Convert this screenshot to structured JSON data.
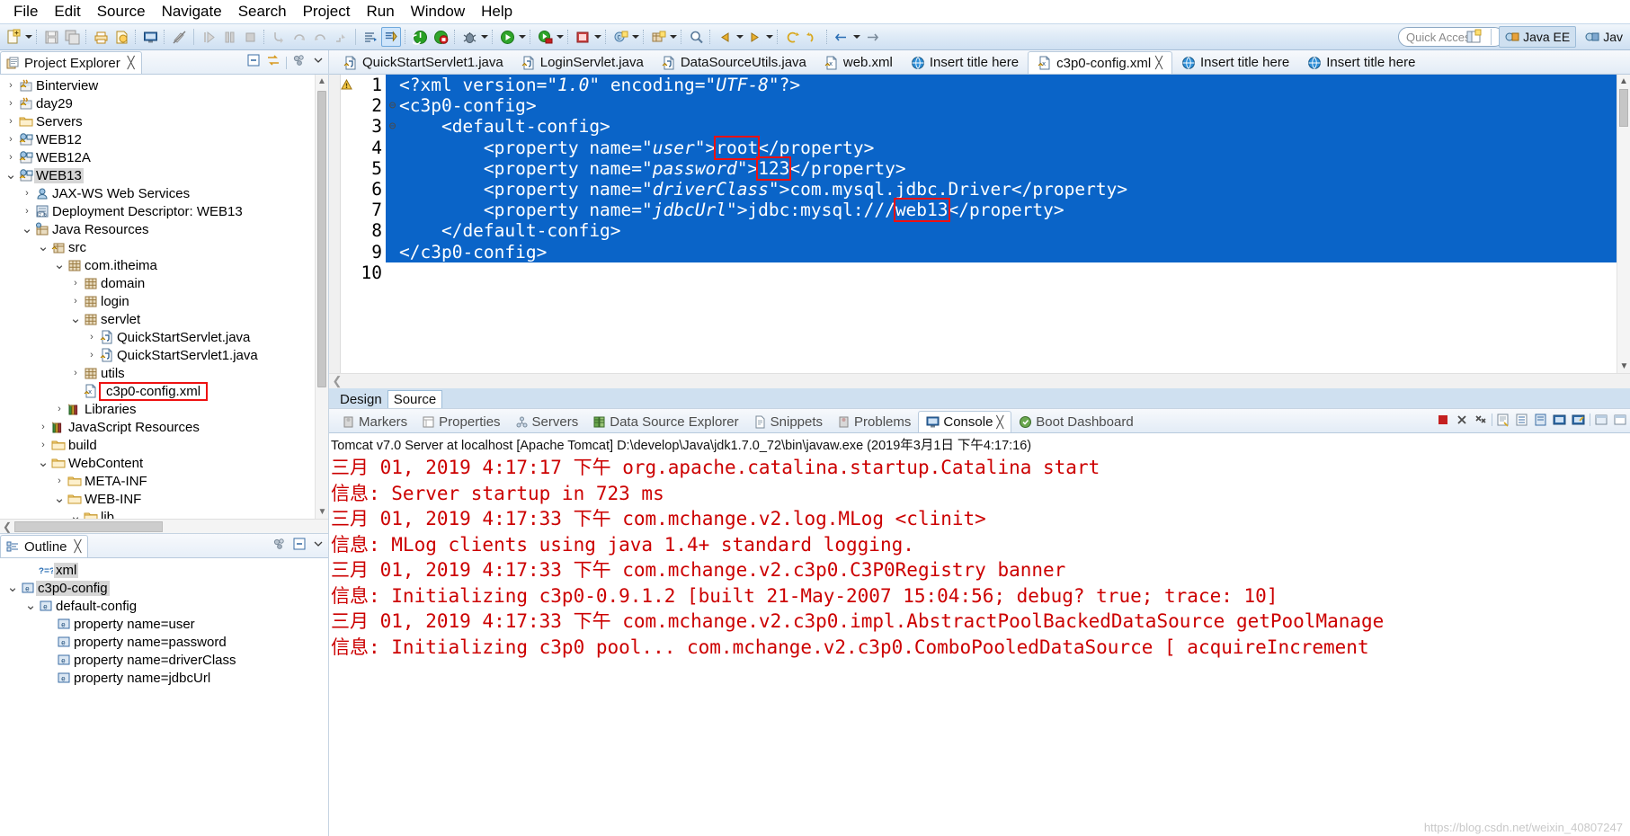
{
  "menu": {
    "items": [
      "File",
      "Edit",
      "Source",
      "Navigate",
      "Search",
      "Project",
      "Run",
      "Window",
      "Help"
    ]
  },
  "toolbar": {
    "quick_access_placeholder": "Quick Access",
    "perspectives": [
      {
        "label": "Java EE",
        "icon": "java-ee-perspective-icon"
      },
      {
        "label": "Jav",
        "icon": "java-perspective-icon"
      }
    ]
  },
  "project_explorer": {
    "title": "Project Explorer",
    "close_glyph": "╳",
    "items": [
      {
        "label": "Binterview",
        "indent": 0,
        "arrow": "›",
        "icon": "java-project-icon",
        "selected": false,
        "boxed": false
      },
      {
        "label": "day29",
        "indent": 0,
        "arrow": "›",
        "icon": "java-project-icon",
        "selected": false,
        "boxed": false
      },
      {
        "label": "Servers",
        "indent": 0,
        "arrow": "›",
        "icon": "folder-icon",
        "selected": false,
        "boxed": false
      },
      {
        "label": "WEB12",
        "indent": 0,
        "arrow": "›",
        "icon": "web-project-icon",
        "selected": false,
        "boxed": false
      },
      {
        "label": "WEB12A",
        "indent": 0,
        "arrow": "›",
        "icon": "web-project-icon",
        "selected": false,
        "boxed": false
      },
      {
        "label": "WEB13",
        "indent": 0,
        "arrow": "⌄",
        "icon": "web-project-icon",
        "selected": true,
        "boxed": false
      },
      {
        "label": "JAX-WS Web Services",
        "indent": 1,
        "arrow": "›",
        "icon": "jaxws-icon",
        "selected": false,
        "boxed": false
      },
      {
        "label": "Deployment Descriptor: WEB13",
        "indent": 1,
        "arrow": "›",
        "icon": "deployment-descriptor-icon",
        "selected": false,
        "boxed": false
      },
      {
        "label": "Java Resources",
        "indent": 1,
        "arrow": "⌄",
        "icon": "java-resources-icon",
        "selected": false,
        "boxed": false
      },
      {
        "label": "src",
        "indent": 2,
        "arrow": "⌄",
        "icon": "source-folder-icon",
        "selected": false,
        "boxed": false
      },
      {
        "label": "com.itheima",
        "indent": 3,
        "arrow": "⌄",
        "icon": "package-icon",
        "selected": false,
        "boxed": false
      },
      {
        "label": "domain",
        "indent": 4,
        "arrow": "›",
        "icon": "package-icon",
        "selected": false,
        "boxed": false
      },
      {
        "label": "login",
        "indent": 4,
        "arrow": "›",
        "icon": "package-icon",
        "selected": false,
        "boxed": false
      },
      {
        "label": "servlet",
        "indent": 4,
        "arrow": "⌄",
        "icon": "package-icon",
        "selected": false,
        "boxed": false
      },
      {
        "label": "QuickStartServlet.java",
        "indent": 5,
        "arrow": "›",
        "icon": "java-file-icon",
        "selected": false,
        "boxed": false
      },
      {
        "label": "QuickStartServlet1.java",
        "indent": 5,
        "arrow": "›",
        "icon": "java-file-icon",
        "selected": false,
        "boxed": false
      },
      {
        "label": "utils",
        "indent": 4,
        "arrow": "›",
        "icon": "package-icon",
        "selected": false,
        "boxed": false
      },
      {
        "label": "c3p0-config.xml",
        "indent": 4,
        "arrow": "",
        "icon": "xml-file-icon",
        "selected": false,
        "boxed": true
      },
      {
        "label": "Libraries",
        "indent": 3,
        "arrow": "›",
        "icon": "libraries-icon",
        "selected": false,
        "boxed": false
      },
      {
        "label": "JavaScript Resources",
        "indent": 2,
        "arrow": "›",
        "icon": "libraries-icon",
        "selected": false,
        "boxed": false
      },
      {
        "label": "build",
        "indent": 2,
        "arrow": "›",
        "icon": "folder-icon",
        "selected": false,
        "boxed": false
      },
      {
        "label": "WebContent",
        "indent": 2,
        "arrow": "⌄",
        "icon": "folder-icon",
        "selected": false,
        "boxed": false
      },
      {
        "label": "META-INF",
        "indent": 3,
        "arrow": "›",
        "icon": "folder-icon",
        "selected": false,
        "boxed": false
      },
      {
        "label": "WEB-INF",
        "indent": 3,
        "arrow": "⌄",
        "icon": "folder-icon",
        "selected": false,
        "boxed": false
      },
      {
        "label": "lib",
        "indent": 4,
        "arrow": "⌄",
        "icon": "folder-icon",
        "selected": false,
        "boxed": false
      }
    ]
  },
  "outline": {
    "title": "Outline",
    "close_glyph": "╳",
    "items": [
      {
        "label": "xml",
        "indent": 1,
        "arrow": "",
        "icon": "processing-instruction-icon",
        "selected": true
      },
      {
        "label": "c3p0-config",
        "indent": 0,
        "arrow": "⌄",
        "icon": "element-icon",
        "selected": true
      },
      {
        "label": "default-config",
        "indent": 1,
        "arrow": "⌄",
        "icon": "element-icon",
        "selected": false
      },
      {
        "label": "property name=user",
        "indent": 2,
        "arrow": "",
        "icon": "element-icon",
        "selected": false
      },
      {
        "label": "property name=password",
        "indent": 2,
        "arrow": "",
        "icon": "element-icon",
        "selected": false
      },
      {
        "label": "property name=driverClass",
        "indent": 2,
        "arrow": "",
        "icon": "element-icon",
        "selected": false
      },
      {
        "label": "property name=jdbcUrl",
        "indent": 2,
        "arrow": "",
        "icon": "element-icon",
        "selected": false
      }
    ]
  },
  "editor": {
    "tabs": [
      {
        "label": "QuickStartServlet1.java",
        "icon": "java-file-icon",
        "active": false,
        "closable": false
      },
      {
        "label": "LoginServlet.java",
        "icon": "java-file-icon",
        "active": false,
        "closable": false
      },
      {
        "label": "DataSourceUtils.java",
        "icon": "java-file-icon",
        "active": false,
        "closable": false
      },
      {
        "label": "web.xml",
        "icon": "xml-file-icon",
        "active": false,
        "closable": false
      },
      {
        "label": "Insert title here",
        "icon": "html-file-icon",
        "active": false,
        "closable": false
      },
      {
        "label": "c3p0-config.xml",
        "icon": "xml-file-icon",
        "active": true,
        "closable": true
      },
      {
        "label": "Insert title here",
        "icon": "html-file-icon",
        "active": false,
        "closable": false
      },
      {
        "label": "Insert title here",
        "icon": "html-file-icon",
        "active": false,
        "closable": false
      }
    ],
    "close_glyph": "╳",
    "bottom_tabs": [
      {
        "label": "Design",
        "active": false
      },
      {
        "label": "Source",
        "active": true
      }
    ],
    "code_lines": [
      {
        "no": "1",
        "fold": "",
        "selected": true,
        "warn": true,
        "segments": [
          {
            "t": "<?xml version=",
            "style": "plain"
          },
          {
            "t": "\"1.0\"",
            "style": "italic"
          },
          {
            "t": " encoding=",
            "style": "plain"
          },
          {
            "t": "\"UTF-8\"",
            "style": "italic"
          },
          {
            "t": "?>",
            "style": "plain"
          }
        ]
      },
      {
        "no": "2",
        "fold": "⊖",
        "selected": true,
        "warn": false,
        "segments": [
          {
            "t": "<c3p0-config>",
            "style": "plain"
          }
        ]
      },
      {
        "no": "3",
        "fold": "⊖",
        "selected": true,
        "warn": false,
        "segments": [
          {
            "t": "    <default-config>",
            "style": "plain"
          }
        ]
      },
      {
        "no": "4",
        "fold": "",
        "selected": true,
        "warn": false,
        "segments": [
          {
            "t": "        <property name=",
            "style": "plain"
          },
          {
            "t": "\"user\"",
            "style": "italic"
          },
          {
            "t": ">",
            "style": "plain"
          },
          {
            "t": "root",
            "style": "boxed"
          },
          {
            "t": "</property>",
            "style": "plain"
          }
        ]
      },
      {
        "no": "5",
        "fold": "",
        "selected": true,
        "warn": false,
        "segments": [
          {
            "t": "        <property name=",
            "style": "plain"
          },
          {
            "t": "\"password\"",
            "style": "italic"
          },
          {
            "t": ">",
            "style": "plain"
          },
          {
            "t": "123",
            "style": "boxed"
          },
          {
            "t": "</property>",
            "style": "plain"
          }
        ]
      },
      {
        "no": "6",
        "fold": "",
        "selected": true,
        "warn": false,
        "segments": [
          {
            "t": "        <property name=",
            "style": "plain"
          },
          {
            "t": "\"driverClass\"",
            "style": "italic"
          },
          {
            "t": ">com.mysql.jdbc.Driver</property>",
            "style": "plain"
          }
        ]
      },
      {
        "no": "7",
        "fold": "",
        "selected": true,
        "warn": false,
        "segments": [
          {
            "t": "        <property name=",
            "style": "plain"
          },
          {
            "t": "\"jdbcUrl\"",
            "style": "italic"
          },
          {
            "t": ">jdbc:mysql:///",
            "style": "plain"
          },
          {
            "t": "web13",
            "style": "boxed"
          },
          {
            "t": "</property>",
            "style": "plain"
          }
        ]
      },
      {
        "no": "8",
        "fold": "",
        "selected": true,
        "warn": false,
        "segments": [
          {
            "t": "    </default-config>",
            "style": "plain"
          }
        ]
      },
      {
        "no": "9",
        "fold": "",
        "selected": true,
        "warn": false,
        "segments": [
          {
            "t": "</c3p0-config>",
            "style": "plain"
          }
        ]
      },
      {
        "no": "10",
        "fold": "",
        "selected": false,
        "warn": false,
        "segments": [
          {
            "t": "",
            "style": "plain"
          }
        ]
      }
    ]
  },
  "console": {
    "tabs": [
      {
        "label": "Markers",
        "icon": "markers-icon",
        "active": false
      },
      {
        "label": "Properties",
        "icon": "properties-icon",
        "active": false
      },
      {
        "label": "Servers",
        "icon": "servers-icon",
        "active": false
      },
      {
        "label": "Data Source Explorer",
        "icon": "data-source-explorer-icon",
        "active": false
      },
      {
        "label": "Snippets",
        "icon": "snippets-icon",
        "active": false
      },
      {
        "label": "Problems",
        "icon": "problems-icon",
        "active": false
      },
      {
        "label": "Console",
        "icon": "console-icon",
        "active": true
      },
      {
        "label": "Boot Dashboard",
        "icon": "boot-dashboard-icon",
        "active": false
      }
    ],
    "close_glyph": "╳",
    "header": "Tomcat v7.0 Server at localhost [Apache Tomcat] D:\\develop\\Java\\jdk1.7.0_72\\bin\\javaw.exe (2019年3月1日 下午4:17:16)",
    "lines": [
      {
        "text": "三月 01, 2019 4:17:17 下午 org.apache.catalina.startup.Catalina start",
        "color": "red"
      },
      {
        "text": "信息: Server startup in 723 ms",
        "color": "red"
      },
      {
        "text": "三月 01, 2019 4:17:33 下午 com.mchange.v2.log.MLog <clinit>",
        "color": "red"
      },
      {
        "text": "信息: MLog clients using java 1.4+ standard logging.",
        "color": "red"
      },
      {
        "text": "三月 01, 2019 4:17:33 下午 com.mchange.v2.c3p0.C3P0Registry banner",
        "color": "red"
      },
      {
        "text": "信息: Initializing c3p0-0.9.1.2 [built 21-May-2007 15:04:56; debug? true; trace: 10]",
        "color": "red"
      },
      {
        "text": "三月 01, 2019 4:17:33 下午 com.mchange.v2.c3p0.impl.AbstractPoolBackedDataSource getPoolManage",
        "color": "red"
      },
      {
        "text": "信息: Initializing c3p0 pool... com.mchange.v2.c3p0.ComboPooledDataSource [ acquireIncrement",
        "color": "red"
      }
    ],
    "watermark": "https://blog.csdn.net/weixin_40807247"
  },
  "colors": {
    "selection_blue": "#0a64c8",
    "annotation_red": "#ee1111",
    "console_red": "#cc0000",
    "chrome_blue": "#cfe0f0"
  }
}
